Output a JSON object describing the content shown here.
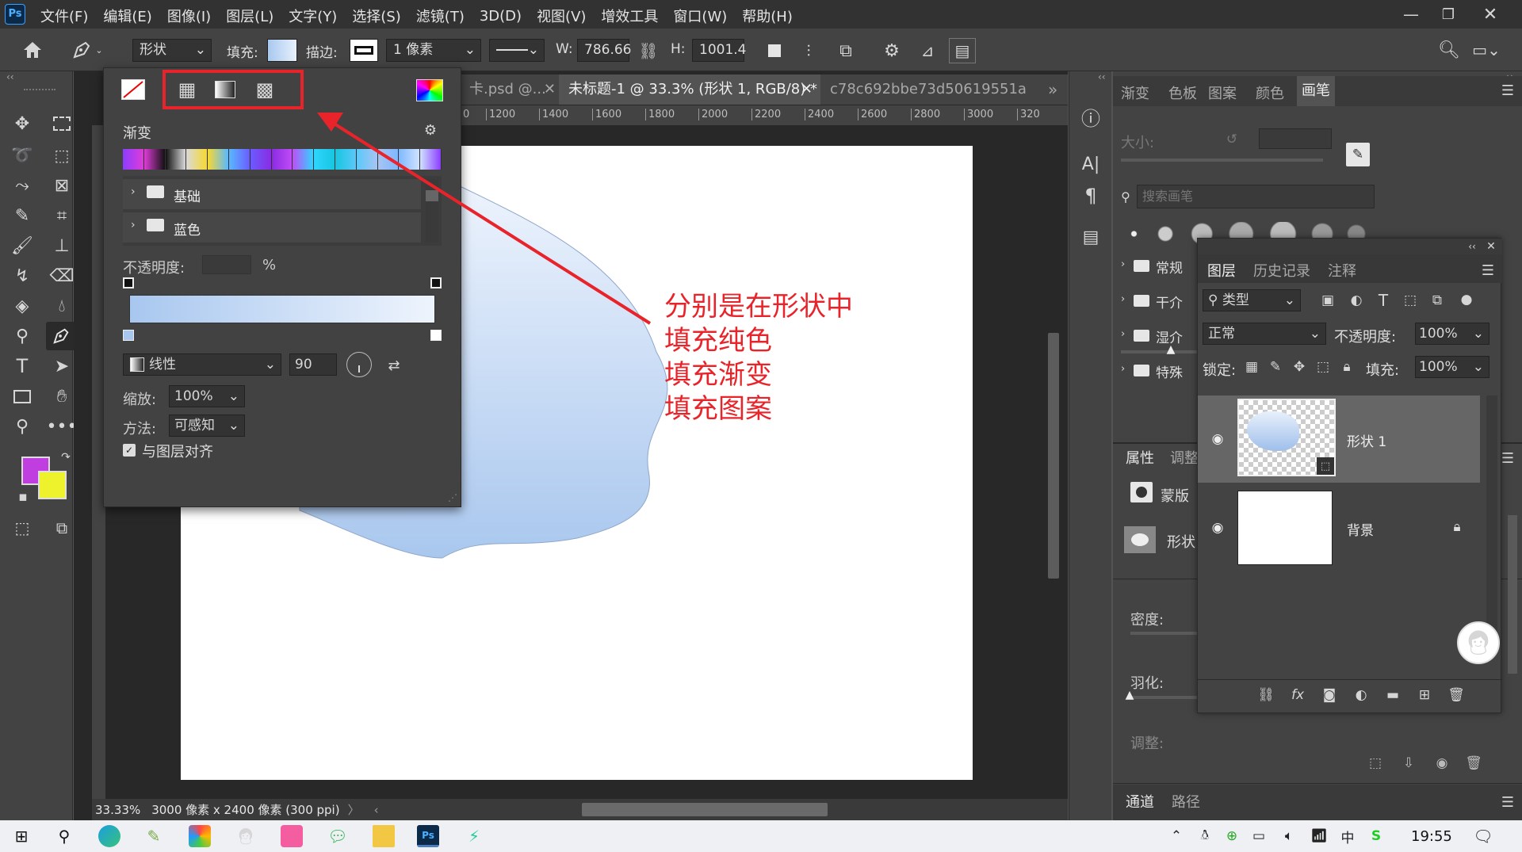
{
  "app_logo": "Ps",
  "menu": [
    "文件(F)",
    "编辑(E)",
    "图像(I)",
    "图层(L)",
    "文字(Y)",
    "选择(S)",
    "滤镜(T)",
    "3D(D)",
    "视图(V)",
    "增效工具",
    "窗口(W)",
    "帮助(H)"
  ],
  "options": {
    "shape_mode": "形状",
    "fill_label": "填充:",
    "stroke_label": "描边:",
    "stroke_width": "1 像素",
    "w_label": "W:",
    "w_value": "786.66",
    "h_label": "H:",
    "h_value": "1001.4"
  },
  "tabs": [
    {
      "label": "卡.psd @...",
      "active": false
    },
    {
      "label": "未标题-1 @ 33.3% (形状 1, RGB/8) *",
      "active": true
    },
    {
      "label": "c78c692bbe73d50619551a",
      "active": false
    }
  ],
  "ruler_ticks": [
    "0",
    "1200",
    "1400",
    "1600",
    "1800",
    "2000",
    "2200",
    "2400",
    "2600",
    "2800",
    "3000",
    "320"
  ],
  "status": {
    "zoom": "33.33%",
    "doc_info": "3000 像素 x 2400 像素 (300 ppi)"
  },
  "popover": {
    "gradient_heading": "渐变",
    "folders": [
      "基础",
      "蓝色"
    ],
    "opacity_label": "不透明度:",
    "opacity_unit": "%",
    "gradient_type": "线性",
    "angle": "90",
    "scale_label": "缩放:",
    "scale_value": "100%",
    "method_label": "方法:",
    "method_value": "可感知",
    "align_label": "与图层对齐",
    "swatch_colors": [
      "#8b3dff",
      "#e03cd8",
      "#111111",
      "#d9d9d9",
      "#f7d930",
      "#5ab8ff",
      "#6a5cff",
      "#8a2be2",
      "#c04cf8",
      "#2fd5ff",
      "#17c6e0",
      "#5ac8fa",
      "#a7c4f2",
      "#7fb8ff",
      "#cfe3ff"
    ]
  },
  "brush_panel": {
    "tabs": [
      "渐变",
      "色板",
      "图案",
      "颜色",
      "画笔"
    ],
    "size_label": "大小:",
    "search_placeholder": "搜索画笔",
    "folders": [
      "常规",
      "干介",
      "湿介",
      "特殊"
    ],
    "props_tabs": [
      "属性",
      "调整"
    ],
    "mask_label": "蒙版",
    "shape_label": "形状",
    "density_label": "密度:",
    "feather_label": "羽化:",
    "adjust_label": "调整:",
    "bottom_tabs": [
      "通道",
      "路径"
    ]
  },
  "layers": {
    "tabs": [
      "图层",
      "历史记录",
      "注释"
    ],
    "kind_filter": "类型",
    "blend_mode": "正常",
    "opacity_label": "不透明度:",
    "opacity_value": "100%",
    "lock_label": "锁定:",
    "fill_label": "填充:",
    "fill_value": "100%",
    "items": [
      {
        "name": "形状 1",
        "selected": true
      },
      {
        "name": "背景",
        "selected": false
      }
    ]
  },
  "annotation": {
    "lines": [
      "分别是在形状中",
      "填充纯色",
      "填充渐变",
      "填充图案"
    ],
    "color": "#e8242a"
  },
  "colors": {
    "foreground": "#c03de0",
    "background": "#eef22c",
    "accent_red": "#e8242a"
  },
  "taskbar": {
    "time": "19:55",
    "ime": "中"
  }
}
